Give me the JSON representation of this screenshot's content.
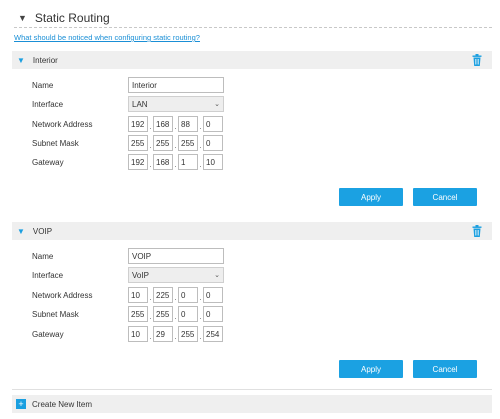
{
  "section": {
    "title": "Static Routing",
    "help_link": "What should be noticed when configuring static routing?"
  },
  "labels": {
    "name": "Name",
    "interface": "Interface",
    "network_address": "Network Address",
    "subnet_mask": "Subnet Mask",
    "gateway": "Gateway"
  },
  "routes": [
    {
      "title": "Interior",
      "name": "Interior",
      "interface": "LAN",
      "network_address": [
        "192",
        "168",
        "88",
        "0"
      ],
      "subnet_mask": [
        "255",
        "255",
        "255",
        "0"
      ],
      "gateway": [
        "192",
        "168",
        "1",
        "10"
      ],
      "apply_label": "Apply",
      "cancel_label": "Cancel"
    },
    {
      "title": "VOIP",
      "name": "VOIP",
      "interface": "VoIP",
      "network_address": [
        "10",
        "225",
        "0",
        "0"
      ],
      "subnet_mask": [
        "255",
        "255",
        "0",
        "0"
      ],
      "gateway": [
        "10",
        "29",
        "255",
        "254"
      ],
      "apply_label": "Apply",
      "cancel_label": "Cancel"
    }
  ],
  "create_new": {
    "label": "Create New Item"
  },
  "colors": {
    "accent": "#1ba1e2",
    "bar_bg": "#efefef",
    "link": "#1a8fd6"
  },
  "icons": {
    "collapse": "triangle-down-icon",
    "delete": "trash-icon",
    "add": "plus-icon",
    "dropdown": "chevron-down-icon"
  }
}
